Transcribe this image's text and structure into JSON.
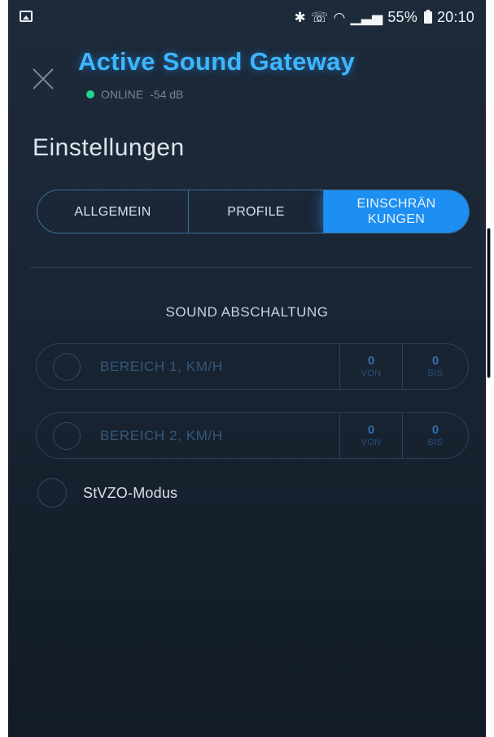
{
  "status_bar": {
    "left_icon": "image-icon",
    "icons": [
      "bluetooth-icon",
      "call-wifi-icon",
      "wifi-icon",
      "signal-icon"
    ],
    "battery_percent": "55%",
    "time": "20:10"
  },
  "header": {
    "close_icon": "close-icon",
    "title": "Active Sound Gateway",
    "connection_status": "ONLINE",
    "signal_strength": "-54 dB"
  },
  "section_title": "Einstellungen",
  "tabs": [
    {
      "label": "ALLGEMEIN",
      "active": false
    },
    {
      "label": "PROFILE",
      "active": false
    },
    {
      "label": "EINSCHRÄN KUNGEN",
      "active": true
    }
  ],
  "subheading": "SOUND ABSCHALTUNG",
  "ranges": [
    {
      "label": "BEREICH 1, KM/H",
      "from_value": "0",
      "from_caption": "VON",
      "to_value": "0",
      "to_caption": "BIS"
    },
    {
      "label": "BEREICH 2, KM/H",
      "from_value": "0",
      "from_caption": "VON",
      "to_value": "0",
      "to_caption": "BIS"
    }
  ],
  "stvzo_label": "StVZO-Modus",
  "colors": {
    "accent": "#1e8ff2",
    "title": "#3db6ff",
    "online": "#26d38c",
    "background": "#1b2736"
  }
}
